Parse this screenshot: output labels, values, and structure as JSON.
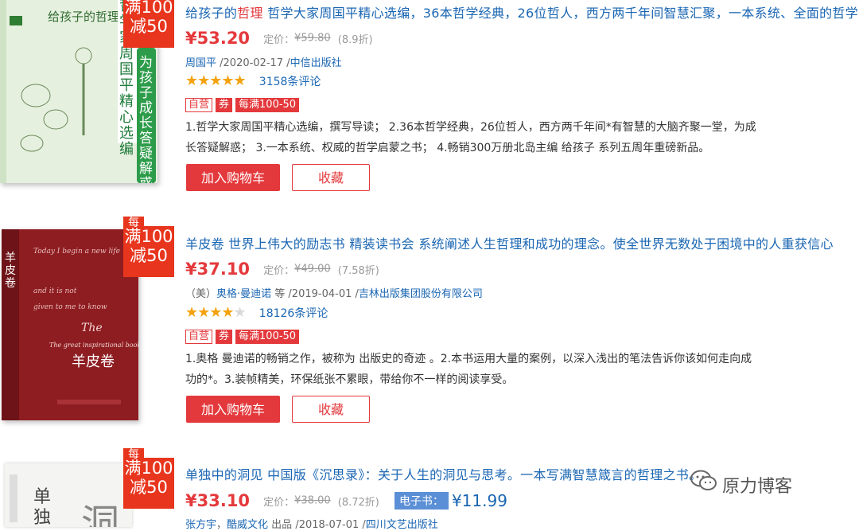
{
  "items": [
    {
      "cover": {
        "bg": "#e8f2e4",
        "spine_title": "给孩子的哲理",
        "vertical_text_1": "哲学家周国平精心选编",
        "vertical_text_2": "为孩子成长答疑解惑"
      },
      "badge": {
        "top": "每",
        "line1": "满100",
        "line2": "减50"
      },
      "title_highlight_prefix": "给孩子的",
      "title_highlight": "哲理",
      "title_rest": "  哲学大家周国平精心选编，36本哲学经典，26位哲人，西方两千年间智慧汇聚，一本系统、全面的哲学",
      "price": "¥53.20",
      "list_label": "定价：",
      "list_price": "¥59.80",
      "discount": "(8.9折)",
      "author": "周国平",
      "date": " /2020-02-17 /",
      "publisher": "中信出版社",
      "stars": "★★★★★",
      "stars_partial": "",
      "reviews": "3158条评论",
      "tag_self": "自营",
      "tag_coupon": "券",
      "tag_promo": "每满100-50",
      "desc_line1": "1.哲学大家周国平精心选编，撰写导读；  2.36本哲学经典，26位哲人，西方两千年间*有智慧的大脑齐聚一堂，为成",
      "desc_line2": "长答疑解惑；  3.一本系统、权威的哲学启蒙之书；  4.畅销300万册北岛主编 给孩子 系列五周年重磅新品。",
      "cart_label": "加入购物车",
      "fav_label": "收藏"
    },
    {
      "cover": {
        "bg": "#8c1c20",
        "spine_title": "羊皮卷",
        "script_text": "The great inspirational book in the world"
      },
      "badge": {
        "top": "每",
        "line1": "满100",
        "line2": "减50"
      },
      "title_text": "羊皮卷  世界上伟大的励志书  精装读书会  系统阐述人生哲理和成功的理念。使全世界无数处于困境中的人重获信心",
      "price": "¥37.10",
      "list_label": "定价：",
      "list_price": "¥49.00",
      "discount": "(7.58折)",
      "author_prefix": "（美）",
      "author": "奥格·曼迪诺",
      "author_suffix": " 等",
      "date": " /2019-04-01 /",
      "publisher": "吉林出版集团股份有限公司",
      "stars": "★★★★",
      "stars_partial": "★",
      "reviews": "18126条评论",
      "tag_self": "自营",
      "tag_coupon": "券",
      "tag_promo": "每满100-50",
      "desc_line1": "1.奥格 曼迪诺的畅销之作，被称为 出版史的奇迹 。2.本书运用大量的案例，以深入浅出的笔法告诉你该如何走向成",
      "desc_line2": "功的*。3.装帧精美，环保纸张不累眼，带给你不一样的阅读享受。",
      "cart_label": "加入购物车",
      "fav_label": "收藏"
    },
    {
      "cover": {
        "bg": "#f4f4f2",
        "big_char_1": "单",
        "big_char_2": "独",
        "big_char_3": "洞"
      },
      "badge": {
        "top": "每",
        "line1": "满100",
        "line2": "减50"
      },
      "title_text": "单独中的洞见  中国版《沉思录》：关于人生的洞见与思考。一本写满智慧箴言的哲理之书。《沉思录》译者何怀宏",
      "price": "¥33.10",
      "list_label": "定价：",
      "list_price": "¥38.00",
      "discount": "(8.72折)",
      "ebook_label": "电子书：",
      "ebook_price": "¥11.99",
      "author": "张方宇",
      "author_sep": "，",
      "author2": "酷威文化",
      "author2_suffix": " 出品",
      "date": " /2018-07-01 /",
      "publisher": "四川文艺出版社"
    }
  ],
  "watermark": {
    "text": "原力博客"
  }
}
